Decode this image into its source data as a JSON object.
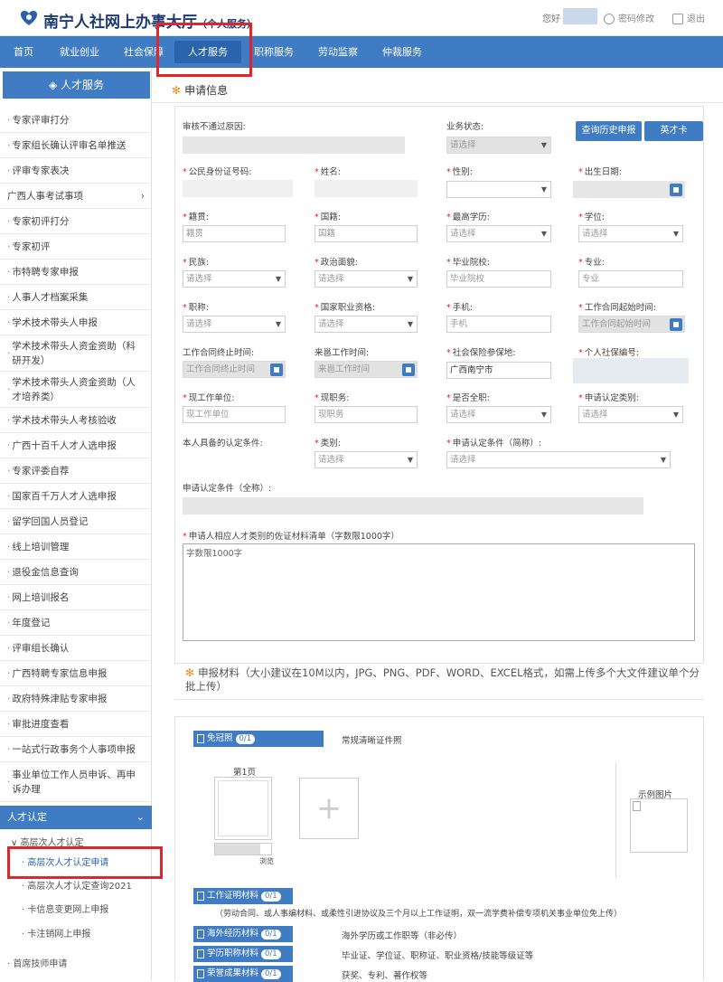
{
  "header": {
    "title": "南宁人社网上办事大厅",
    "title_suffix": "（个人服务）",
    "greeting": "您好",
    "change_password": "密码修改",
    "logout": "退出"
  },
  "nav": {
    "items": [
      {
        "label": "首页"
      },
      {
        "label": "就业创业"
      },
      {
        "label": "社会保障"
      },
      {
        "label": "人才服务"
      },
      {
        "label": "职称服务"
      },
      {
        "label": "劳动监察"
      },
      {
        "label": "仲裁服务"
      }
    ],
    "active_index": 3
  },
  "sidebar": {
    "title": "人才服务",
    "items": [
      {
        "label": "专家评审打分"
      },
      {
        "label": "专家组长确认评审名单推送"
      },
      {
        "label": "评审专家表决"
      },
      {
        "label": "广西人事考试事项"
      },
      {
        "label": "专家初评打分"
      },
      {
        "label": "专家初评"
      },
      {
        "label": "市特聘专家申报"
      },
      {
        "label": "人事人才档案采集"
      },
      {
        "label": "学术技术带头人申报"
      },
      {
        "label": "学术技术带头人资金资助（科研开发）"
      },
      {
        "label": "学术技术带头人资金资助（人才培养类）"
      },
      {
        "label": "学术技术带头人考核验收"
      },
      {
        "label": "广西十百千人才人选申报"
      },
      {
        "label": "专家评委自荐"
      },
      {
        "label": "国家百千万人才人选申报"
      },
      {
        "label": "留学回国人员登记"
      },
      {
        "label": "线上培训管理"
      },
      {
        "label": "退役金信息查询"
      },
      {
        "label": "网上培训报名"
      },
      {
        "label": "年度登记"
      },
      {
        "label": "评审组长确认"
      },
      {
        "label": "广西特聘专家信息申报"
      },
      {
        "label": "政府特殊津贴专家申报"
      },
      {
        "label": "审批进度查看"
      },
      {
        "label": "一站式行政事务个人事项申报"
      },
      {
        "label": "事业单位工作人员申诉、再申诉办理"
      }
    ],
    "group_label": "人才认定",
    "subgroup_label": "高层次人才认定",
    "sub_items": [
      {
        "label": "高层次人才认定申请"
      },
      {
        "label": "高层次人才认定查询2021"
      },
      {
        "label": "卡信息变更网上申报"
      },
      {
        "label": "卡注销网上申报"
      }
    ],
    "bottom_item": "首席技师申请"
  },
  "form": {
    "section_title": "申请信息",
    "reject_reason_label": "审核不通过原因:",
    "status_label": "业务状态:",
    "status_placeholder": "请选择",
    "history_button": "查询历史申报",
    "talent_card_button": "英才卡",
    "fields": {
      "id_label": "公民身份证号码:",
      "name_label": "姓名:",
      "gender_label": "性别:",
      "birth_label": "出生日期:",
      "origin_label": "籍贯:",
      "origin_ph": "籍贯",
      "nationality_label": "国籍:",
      "nationality_ph": "国籍",
      "education_label": "最高学历:",
      "degree_label": "学位:",
      "ethnicity_label": "民族:",
      "politics_label": "政治面貌:",
      "school_label": "毕业院校:",
      "school_ph": "毕业院校",
      "major_label": "专业:",
      "major_ph": "专业",
      "title_label": "职称:",
      "qualification_label": "国家职业资格:",
      "phone_label": "手机:",
      "phone_ph": "手机",
      "contract_start_label": "工作合同起始时间:",
      "contract_start_ph": "工作合同起始时间",
      "contract_end_label": "工作合同终止时间:",
      "contract_end_ph": "工作合同终止时间",
      "arrive_label": "来邕工作时间:",
      "arrive_ph": "来邕工作时间",
      "insurance_place_label": "社会保险参保地:",
      "insurance_place_value": "广西南宁市",
      "social_no_label": "个人社保编号:",
      "employer_label": "现工作单位:",
      "employer_ph": "现工作单位",
      "position_label": "现职务:",
      "position_ph": "现职务",
      "fulltime_label": "是否全职:",
      "category_label": "申请认定类别:",
      "own_conditions_label": "本人具备的认定条件:",
      "type_label": "类别:",
      "short_condition_label": "申请认定条件（简称）:",
      "full_condition_label": "申请认定条件（全称）:",
      "materials_list_label": "申请人相应人才类别的佐证材料清单（字数限1000字）",
      "materials_list_ph": "字数限1000字",
      "select_ph": "请选择"
    }
  },
  "upload": {
    "title": "申报材料",
    "note": "（大小建议在10M以内，JPG、PNG、PDF、WORD、EXCEL格式，如需上传多个大文件建议单个分批上传）",
    "materials": [
      {
        "tag": "免冠照",
        "count": "0/1",
        "desc": "常规清晰证件照"
      },
      {
        "tag": "工作证明材料",
        "count": "0/1",
        "desc": "（劳动合同、或人事编材料、或柔性引进协议及三个月以上工作证明，双一流学费补偿专项机关事业单位免上传）"
      },
      {
        "tag": "海外经历材料",
        "count": "0/1",
        "desc": "海外学历或工作职等（非必传）"
      },
      {
        "tag": "学历职称材料",
        "count": "0/1",
        "desc": "毕业证、学位证、职称证、职业资格/技能等级证等"
      },
      {
        "tag": "荣誉成果材料",
        "count": "0/1",
        "desc": "获奖、专利、著作权等"
      }
    ],
    "page_label": "第1页",
    "browse_label": "浏览",
    "sample_label": "示例图片"
  }
}
